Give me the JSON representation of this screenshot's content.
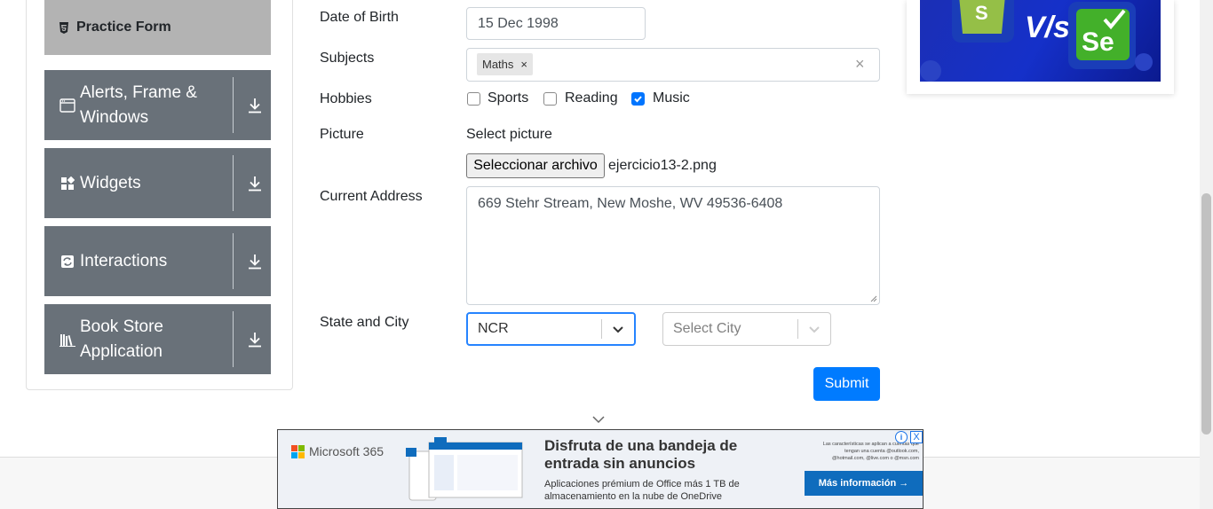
{
  "sidebar": {
    "practice_form": "Practice Form",
    "groups": [
      {
        "label": "Alerts, Frame & Windows",
        "icon": "window-icon"
      },
      {
        "label": "Widgets",
        "icon": "widgets-icon"
      },
      {
        "label": "Interactions",
        "icon": "interactions-icon"
      },
      {
        "label": "Book Store Application",
        "icon": "books-icon"
      }
    ]
  },
  "form": {
    "dob_label": "Date of Birth",
    "dob_value": "15 Dec 1998",
    "subjects_label": "Subjects",
    "subject_chip": "Maths",
    "chip_remove": "×",
    "subjects_clear": "×",
    "hobbies_label": "Hobbies",
    "hobbies": [
      {
        "label": "Sports",
        "checked": false
      },
      {
        "label": "Reading",
        "checked": false
      },
      {
        "label": "Music",
        "checked": true
      }
    ],
    "picture_label": "Picture",
    "select_picture": "Select picture",
    "file_button": "Seleccionar archivo",
    "file_name": "ejercicio13-2.png",
    "address_label": "Current Address",
    "address_value": "669 Stehr Stream, New Moshe, WV 49536-6408",
    "state_city_label": "State and City",
    "state_value": "NCR",
    "city_placeholder": "Select City",
    "submit": "Submit"
  },
  "bottom_ad": {
    "brand": "Microsoft 365",
    "headline": "Disfruta de una bandeja de entrada sin anuncios",
    "sub": "Aplicaciones prémium de Office más 1 TB de almacenamiento en la nube de OneDrive",
    "small_print": "Las características se aplican a cuentas que tengan una cuenta @outlook.com, @hotmail.com, @live.com o @msn.com",
    "cta": "Más información →",
    "close": "X",
    "info": "i"
  },
  "colors": {
    "sidebar_group": "#697179",
    "practice_active": "#b3b3b3",
    "primary": "#007bff",
    "checkbox_checked": "#0075ff",
    "ad_blue": "#1530c9"
  }
}
